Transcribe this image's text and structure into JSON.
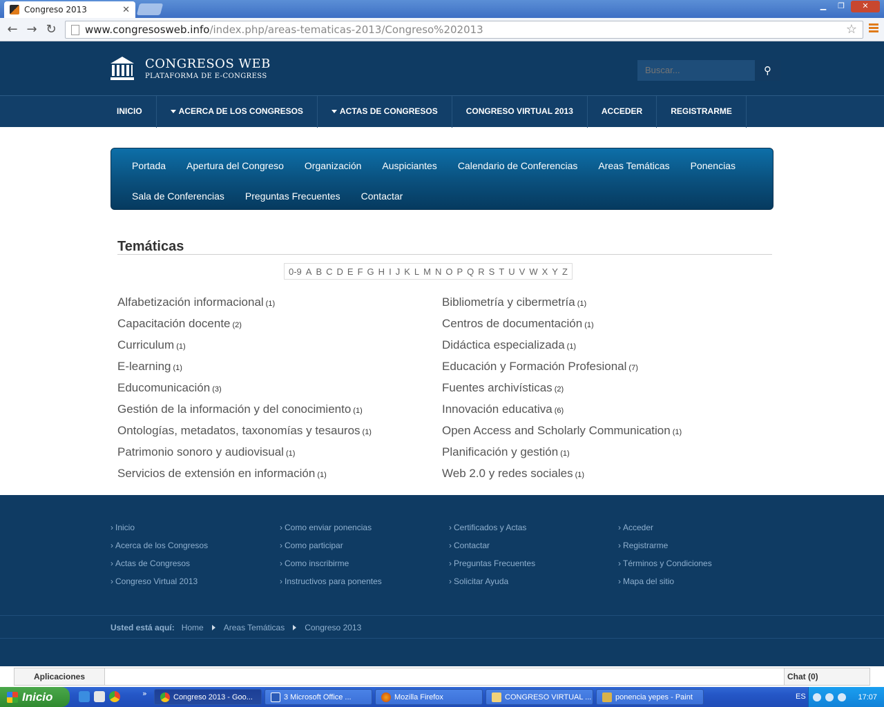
{
  "browser": {
    "tab_title": "Congreso 2013",
    "url_host": "www.congresosweb.info",
    "url_path": "/index.php/areas-tematicas-2013/Congreso%202013"
  },
  "site": {
    "logo_title": "CONGRESOS WEB",
    "logo_subtitle": "PLATAFORMA DE E-CONGRESS",
    "search_placeholder": "Buscar...",
    "main_nav": [
      "INICIO",
      "ACERCA DE LOS CONGRESOS",
      "ACTAS DE CONGRESOS",
      "CONGRESO VIRTUAL 2013",
      "ACCEDER",
      "REGISTRARME"
    ],
    "sub_nav": [
      "Portada",
      "Apertura del Congreso",
      "Organización",
      "Auspiciantes",
      "Calendario de Conferencias",
      "Areas Temáticas",
      "Ponencias",
      "Sala de Conferencias",
      "Preguntas Frecuentes",
      "Contactar"
    ]
  },
  "content": {
    "title": "Temáticas",
    "alphabet": [
      "0-9",
      "A",
      "B",
      "C",
      "D",
      "E",
      "F",
      "G",
      "H",
      "I",
      "J",
      "K",
      "L",
      "M",
      "N",
      "O",
      "P",
      "Q",
      "R",
      "S",
      "T",
      "U",
      "V",
      "W",
      "X",
      "Y",
      "Z"
    ],
    "topics": [
      {
        "name": "Alfabetización informacional",
        "count": "(1)"
      },
      {
        "name": "Bibliometría y cibermetría",
        "count": "(1)"
      },
      {
        "name": "Capacitación docente",
        "count": "(2)"
      },
      {
        "name": "Centros de documentación",
        "count": "(1)"
      },
      {
        "name": "Curriculum",
        "count": "(1)"
      },
      {
        "name": "Didáctica especializada",
        "count": "(1)"
      },
      {
        "name": "E-learning",
        "count": "(1)"
      },
      {
        "name": "Educación y Formación Profesional",
        "count": "(7)"
      },
      {
        "name": "Educomunicación",
        "count": "(3)"
      },
      {
        "name": "Fuentes archivísticas",
        "count": "(2)"
      },
      {
        "name": "Gestión de la información y del conocimiento",
        "count": "(1)"
      },
      {
        "name": "Innovación educativa",
        "count": "(6)"
      },
      {
        "name": "Ontologías, metadatos, taxonomías y tesauros",
        "count": "(1)"
      },
      {
        "name": "Open Access and Scholarly Communication",
        "count": "(1)"
      },
      {
        "name": "Patrimonio sonoro y audiovisual",
        "count": "(1)"
      },
      {
        "name": "Planificación y gestión",
        "count": "(1)"
      },
      {
        "name": "Servicios de extensión en información",
        "count": "(1)"
      },
      {
        "name": "Web 2.0 y redes sociales",
        "count": "(1)"
      }
    ]
  },
  "footer": {
    "columns": [
      [
        "Inicio",
        "Acerca de los Congresos",
        "Actas de Congresos",
        "Congreso Virtual 2013"
      ],
      [
        "Como enviar ponencias",
        "Como participar",
        "Como inscribirme",
        "Instructivos para ponentes"
      ],
      [
        "Certificados y Actas",
        "Contactar",
        "Preguntas Frecuentes",
        "Solicitar Ayuda"
      ],
      [
        "Acceder",
        "Registrarme",
        "Términos y Condiciones",
        "Mapa del sitio"
      ]
    ],
    "breadcrumb_label": "Usted está aquí:",
    "breadcrumb": [
      "Home",
      "Areas Temáticas",
      "Congreso 2013"
    ]
  },
  "chrome_bar": {
    "apps": "Aplicaciones",
    "chat": "Chat (0)"
  },
  "taskbar": {
    "start": "Inicio",
    "tasks": [
      "Congreso 2013 - Goo...",
      "3 Microsoft Office ...",
      "Mozilla Firefox",
      "CONGRESO VIRTUAL ...",
      "ponencia yepes - Paint"
    ],
    "lang": "ES",
    "clock": "17:07"
  },
  "colors": {
    "header_bg": "#0f3b63",
    "subnav_bg": "#0a4f7c",
    "link_text": "#555555"
  }
}
